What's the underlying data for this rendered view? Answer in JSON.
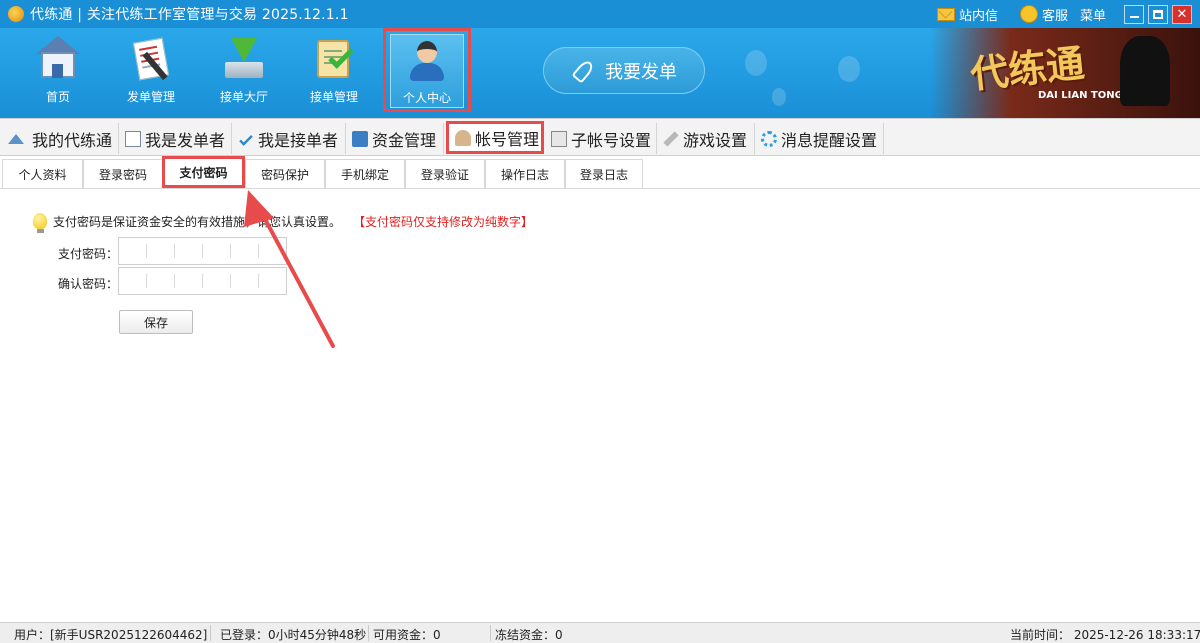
{
  "window": {
    "title": "代练通 | 关注代练工作室管理与交易 2025.12.1.1",
    "inbox_label": "站内信",
    "service_label": "客服",
    "menu_label": "菜单"
  },
  "toolbar": {
    "items": [
      {
        "label": "首页",
        "icon": "home-icon"
      },
      {
        "label": "发单管理",
        "icon": "order-publish-icon"
      },
      {
        "label": "接单大厅",
        "icon": "order-hall-icon"
      },
      {
        "label": "接单管理",
        "icon": "order-manage-icon"
      },
      {
        "label": "个人中心",
        "icon": "personal-center-icon"
      }
    ],
    "publish_button": "我要发单",
    "brand_text": "代练通",
    "brand_subtext": "DAI LIAN TONG"
  },
  "main_tabs": [
    {
      "label": "我的代练通",
      "icon": "home-icon"
    },
    {
      "label": "我是发单者",
      "icon": "document-icon"
    },
    {
      "label": "我是接单者",
      "icon": "check-icon"
    },
    {
      "label": "资金管理",
      "icon": "money-icon"
    },
    {
      "label": "帐号管理",
      "icon": "user-icon",
      "active": true
    },
    {
      "label": "子帐号设置",
      "icon": "sub-account-icon"
    },
    {
      "label": "游戏设置",
      "icon": "wrench-icon"
    },
    {
      "label": "消息提醒设置",
      "icon": "gear-icon"
    }
  ],
  "sub_tabs": [
    {
      "label": "个人资料"
    },
    {
      "label": "登录密码"
    },
    {
      "label": "支付密码",
      "active": true
    },
    {
      "label": "密码保护"
    },
    {
      "label": "手机绑定"
    },
    {
      "label": "登录验证"
    },
    {
      "label": "操作日志"
    },
    {
      "label": "登录日志"
    }
  ],
  "content": {
    "notice": "支付密码是保证资金安全的有效措施，请您认真设置。",
    "notice_warning": "【支付密码仅支持修改为纯数字】",
    "pay_password_label": "支付密码：",
    "confirm_password_label": "确认密码：",
    "save_button": "保存"
  },
  "status_bar": {
    "user": "用户：[新手USR2025122604462]",
    "logged_in": "已登录：0小时45分钟48秒",
    "available_funds": "可用资金：0",
    "frozen_funds": "冻结资金：0",
    "current_time": "当前时间：  2025-12-26 18:33:17"
  },
  "colors": {
    "titlebar": "#1b8fd6",
    "toolbar": "#2aa8ea",
    "highlight": "#e74b4b",
    "warning_text": "#e02020"
  }
}
